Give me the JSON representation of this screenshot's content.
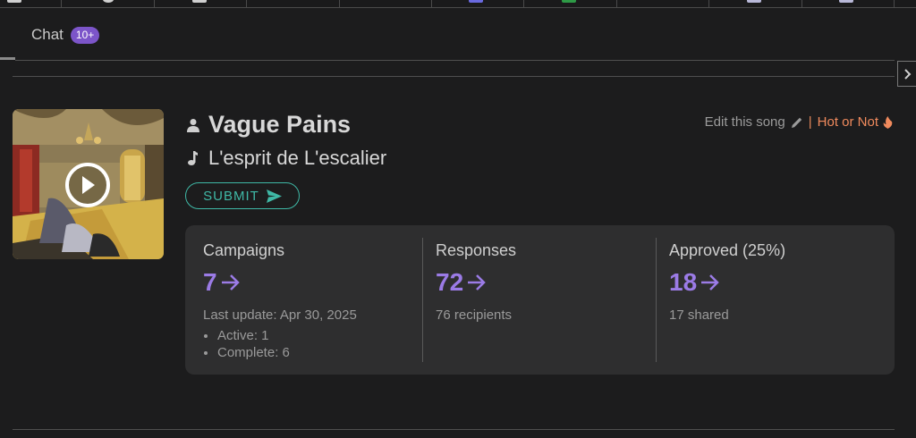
{
  "tabs": {
    "chat_label": "Chat",
    "chat_badge": "10+"
  },
  "song": {
    "artist": "Vague Pains",
    "title": "L'esprit de L'escalier",
    "submit_label": "SUBMIT"
  },
  "links": {
    "edit_label": "Edit this song",
    "separator": "|",
    "hot_label": "Hot or Not"
  },
  "stats": {
    "campaigns": {
      "label": "Campaigns",
      "value": "7",
      "sub": "Last update: Apr 30, 2025",
      "details": [
        "Active: 1",
        "Complete: 6"
      ]
    },
    "responses": {
      "label": "Responses",
      "value": "72",
      "sub": "76 recipients"
    },
    "approved": {
      "label": "Approved (25%)",
      "value": "18",
      "sub": "17 shared"
    }
  },
  "icons": {
    "artist": "person-icon",
    "song": "music-note-icon",
    "submit": "send-icon",
    "edit": "pencil-icon",
    "hot": "flame-icon",
    "play": "play-icon",
    "side": "chevron-right-icon"
  },
  "colors": {
    "accent_purple": "#9b7be6",
    "badge_purple": "#7c55c9",
    "teal": "#3fb8a6",
    "hot_orange": "#f08a5d",
    "background": "#1c1c1d",
    "card": "#2e2e2f"
  }
}
